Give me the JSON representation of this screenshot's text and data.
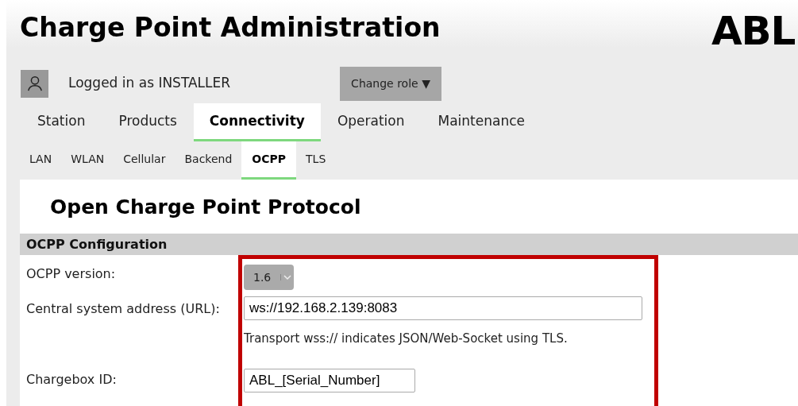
{
  "header": {
    "title": "Charge Point Administration",
    "logo": "ABL"
  },
  "user": {
    "text": "Logged in as INSTALLER",
    "button": "Change role ▼"
  },
  "tabs": [
    {
      "label": "Station",
      "selected": false
    },
    {
      "label": "Products",
      "selected": false
    },
    {
      "label": "Connectivity",
      "selected": true
    },
    {
      "label": "Operation",
      "selected": false
    },
    {
      "label": "Maintenance",
      "selected": false
    }
  ],
  "subtabs": [
    {
      "label": "LAN",
      "selected": false
    },
    {
      "label": "WLAN",
      "selected": false
    },
    {
      "label": "Cellular",
      "selected": false
    },
    {
      "label": "Backend",
      "selected": false
    },
    {
      "label": "OCPP",
      "selected": true
    },
    {
      "label": "TLS",
      "selected": false
    }
  ],
  "page_title": "Open Charge Point Protocol",
  "section": "OCPP Configuration",
  "fields": [
    {
      "kind": "select",
      "label": "OCPP version:",
      "value": "1.6"
    },
    {
      "kind": "text",
      "label": "Central system address (URL):",
      "value": "ws://192.168.2.139:8083",
      "hint": "Transport wss:// indicates JSON/Web-Socket using TLS."
    },
    {
      "kind": "short",
      "label": "Chargebox ID:",
      "value": "ABL_[Serial_Number]"
    }
  ]
}
